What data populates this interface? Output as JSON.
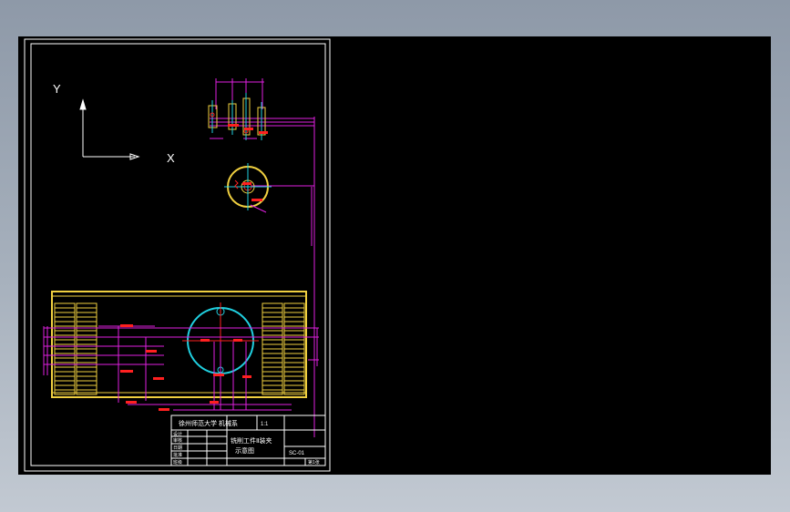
{
  "canvas": {
    "background": "#000000",
    "line_colors": {
      "border": "#ffffff",
      "part": "#f0d040",
      "dimension": "#e020e0",
      "cyan": "#20d0e0",
      "red": "#ff2020"
    }
  },
  "axes": {
    "x_label": "X",
    "y_label": "Y"
  },
  "title_block": {
    "school": "徐州师范大学 机械系",
    "scale": "1:1",
    "material": "",
    "drawing_name_line1": "铣削工件Ⅱ装夹",
    "drawing_name_line2": "示意图",
    "drawing_no": "SC-01",
    "sheet": "第1张",
    "rows": [
      {
        "role": "设计",
        "name": ""
      },
      {
        "role": "审核",
        "name": ""
      },
      {
        "role": "日期",
        "name": ""
      },
      {
        "role": "批准",
        "name": ""
      },
      {
        "role": "班级",
        "name": ""
      }
    ]
  }
}
